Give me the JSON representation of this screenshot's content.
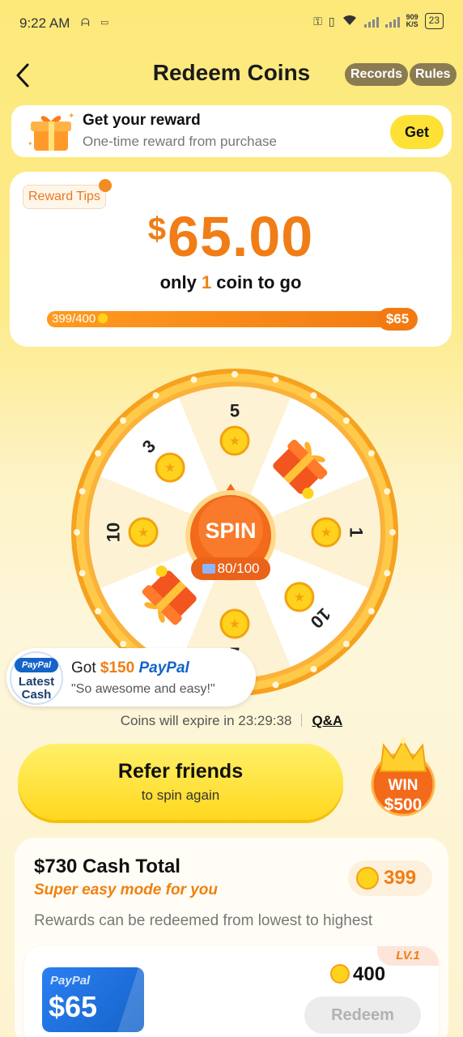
{
  "status_bar": {
    "time": "9:22 AM",
    "speed_value": "909",
    "speed_unit": "K/S",
    "battery": "23"
  },
  "header": {
    "title": "Redeem Coins",
    "records_label": "Records",
    "rules_label": "Rules"
  },
  "get_reward": {
    "title": "Get your reward",
    "subtitle": "One-time reward from purchase",
    "button_label": "Get"
  },
  "reward_card": {
    "tips_label": "Reward Tips",
    "currency": "$",
    "amount": "65.00",
    "togo_prefix": "only ",
    "togo_count": "1",
    "togo_suffix": " coin to go",
    "progress_label": "399/400",
    "progress_current": 399,
    "progress_total": 400,
    "progress_target": "$65"
  },
  "wheel": {
    "segments": [
      {
        "label": "5",
        "type": "coin"
      },
      {
        "label": "",
        "type": "gift"
      },
      {
        "label": "1",
        "type": "coin"
      },
      {
        "label": "10",
        "type": "coin"
      },
      {
        "label": "2",
        "type": "coin"
      },
      {
        "label": "",
        "type": "gift"
      },
      {
        "label": "10",
        "type": "coin"
      },
      {
        "label": "3",
        "type": "coin"
      }
    ],
    "spin_label": "SPIN",
    "spin_count": "80/100"
  },
  "latest_cash": {
    "badge_brand": "PayPal",
    "badge_line1": "Latest",
    "badge_line2": "Cash",
    "got_prefix": "Got ",
    "got_amount": "$150",
    "got_brand": "PayPal",
    "quote": "\"So awesome and easy!\""
  },
  "expire": {
    "text": "Coins will expire in 23:29:38",
    "qa_label": "Q&A"
  },
  "refer": {
    "title": "Refer friends",
    "subtitle": "to spin again",
    "win_line1": "WIN",
    "win_line2": "$500"
  },
  "cash_panel": {
    "title": "$730 Cash Total",
    "subtitle": "Super easy mode for you",
    "description": "Rewards can be redeemed from lowest to highest",
    "coin_balance": "399",
    "item": {
      "level": "LV.1",
      "card_brand": "PayPal",
      "card_amount": "$65",
      "cost": "400",
      "redeem_label": "Redeem"
    }
  },
  "colors": {
    "accent_orange": "#f07d16",
    "brand_yellow": "#fde235",
    "paypal_blue": "#1463c8"
  },
  "icons": [
    "back-arrow-icon",
    "gift-icon",
    "coin-icon",
    "crown-icon",
    "ticket-icon",
    "key-icon",
    "wifi-icon",
    "signal-icon",
    "battery-icon"
  ]
}
